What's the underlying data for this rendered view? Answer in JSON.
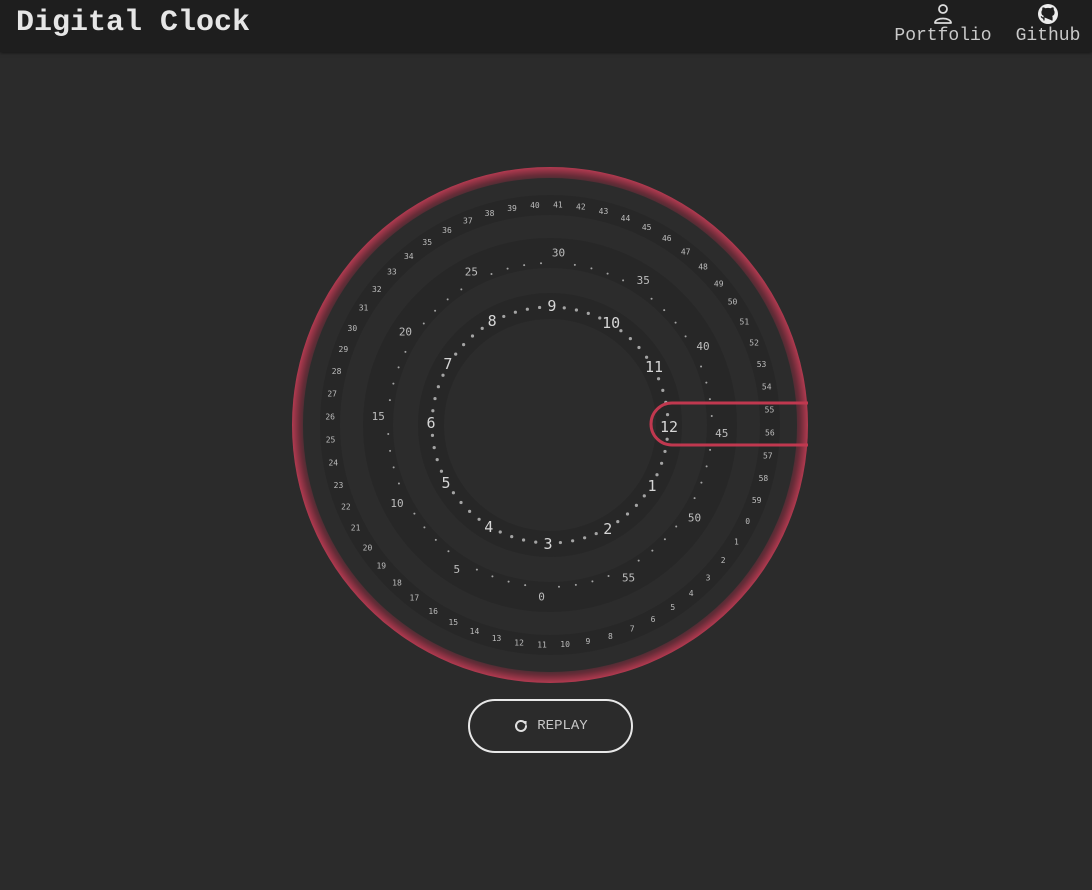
{
  "header": {
    "title": "Digital Clock",
    "nav": [
      {
        "label": "Portfolio",
        "icon": "user-icon"
      },
      {
        "label": "Github",
        "icon": "github-icon"
      }
    ]
  },
  "clock": {
    "colors": {
      "accent": "#c0384f",
      "dial_label": "#bdbdbd",
      "hour_label": "#d6d6d6",
      "dot": "#cfcfcf",
      "ring_dark": "#242424"
    },
    "second_labels": [
      "0",
      "1",
      "2",
      "3",
      "4",
      "5",
      "6",
      "7",
      "8",
      "9",
      "10",
      "11",
      "12",
      "13",
      "14",
      "15",
      "16",
      "17",
      "18",
      "19",
      "20",
      "21",
      "22",
      "23",
      "24",
      "25",
      "26",
      "27",
      "28",
      "29",
      "30",
      "31",
      "32",
      "33",
      "34",
      "35",
      "36",
      "37",
      "38",
      "39",
      "40",
      "41",
      "42",
      "43",
      "44",
      "45",
      "46",
      "47",
      "48",
      "49",
      "50",
      "51",
      "52",
      "53",
      "54",
      "55",
      "56",
      "57",
      "58",
      "59"
    ],
    "minute_labels": [
      "0",
      "5",
      "10",
      "15",
      "20",
      "25",
      "30",
      "35",
      "40",
      "45",
      "50",
      "55"
    ],
    "hour_labels": [
      "1",
      "2",
      "3",
      "4",
      "5",
      "6",
      "7",
      "8",
      "9",
      "10",
      "11",
      "12"
    ]
  },
  "replay": {
    "label": "REPLAY",
    "icon": "refresh-icon"
  }
}
